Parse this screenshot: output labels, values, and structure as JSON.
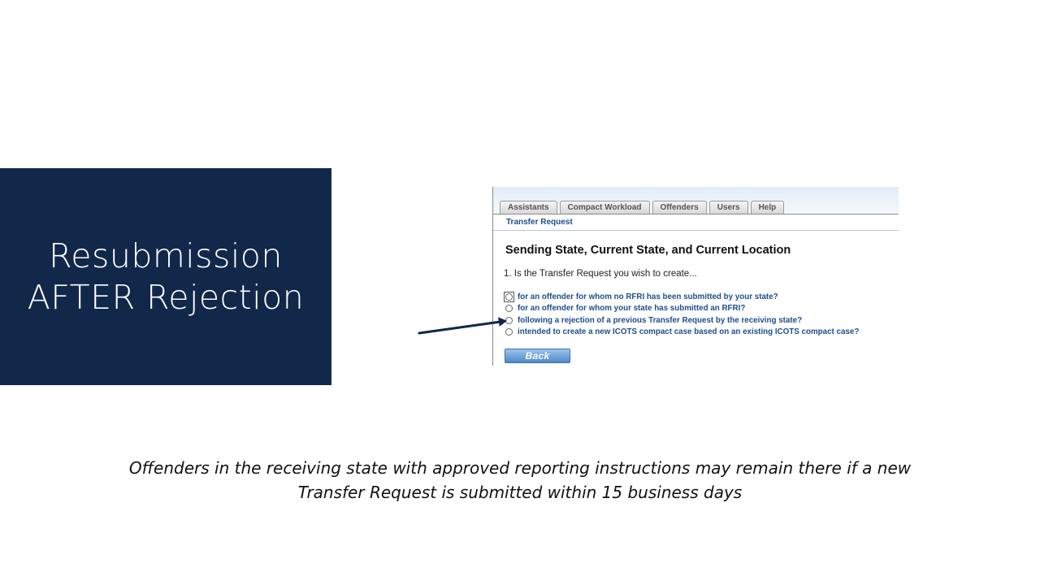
{
  "slide": {
    "title_lines": [
      "Resubmission",
      "AFTER Rejection"
    ],
    "caption_lines": [
      "Offenders in the receiving state with approved reporting instructions may remain there if a new",
      "Transfer Request is submitted within 15 business days"
    ]
  },
  "app": {
    "tabs": [
      "Assistants",
      "Compact Workload",
      "Offenders",
      "Users",
      "Help"
    ],
    "breadcrumb": "Transfer Request",
    "heading": "Sending State, Current State, and Current Location",
    "question": "1. Is the Transfer Request you wish to create...",
    "options": [
      "for an offender for whom no RFRI has been submitted by your state?",
      "for an offender for whom your state has submitted an RFRI?",
      "following a rejection of a previous Transfer Request by the receiving state?",
      "intended to create a new ICOTS compact case based on an existing ICOTS compact case?"
    ],
    "back_label": "Back"
  },
  "colors": {
    "title_bg": "#12284a",
    "link_blue": "#1f4e8c",
    "arrow": "#12284a"
  }
}
